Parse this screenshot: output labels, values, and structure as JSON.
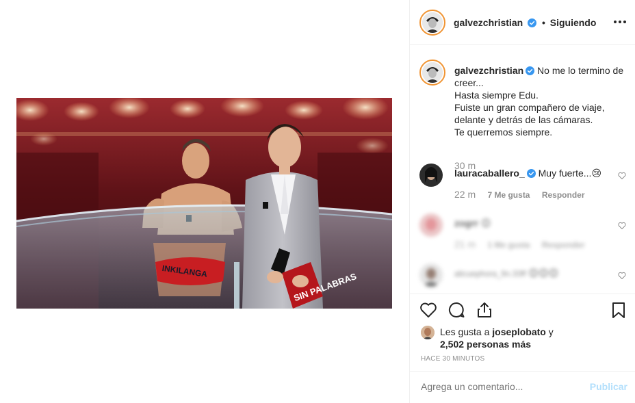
{
  "post": {
    "author": "galvezchristian",
    "follow_status": "Siguiendo",
    "separator": "•"
  },
  "caption": {
    "username": "galvezchristian",
    "lines": [
      "No me lo termino de",
      "creer...",
      "Hasta siempre Edu.",
      "Fuiste un gran compañero de viaje,",
      "delante y detrás de las cámaras.",
      "Te querremos siempre."
    ],
    "time": "30 m"
  },
  "comments": [
    {
      "username": "lauracaballero_",
      "text": "Muy fuerte...",
      "emoji": "😢",
      "time": "22 m",
      "likes": "7 Me gusta",
      "reply": "Responder"
    },
    {
      "username": "zogrr",
      "text": "😊",
      "time": "21 m",
      "likes": "1 Me gusta",
      "reply": "Responder"
    },
    {
      "username": "alicuephora_fin.33ff",
      "text": "😊😊😊"
    }
  ],
  "likes": {
    "prefix": "Les gusta a",
    "user": "joseplobato",
    "conj": "y",
    "count": "2,502 personas más"
  },
  "time_ago": "HACE 30 MINUTOS",
  "comment_box": {
    "placeholder": "Agrega un comentario...",
    "publish": "Publicar"
  },
  "icons": {
    "more": "more-options-icon",
    "like": "heart-icon",
    "comment": "comment-icon",
    "share": "share-icon",
    "save": "bookmark-icon",
    "verified": "verified-badge-icon"
  },
  "colors": {
    "verified": "#3897f0",
    "publish_disabled": "#b2dffc",
    "muted": "#8e8e8e",
    "border": "#efefef",
    "ring": "#f09433"
  },
  "photo_overlay_text": "SIN PALABRAS"
}
